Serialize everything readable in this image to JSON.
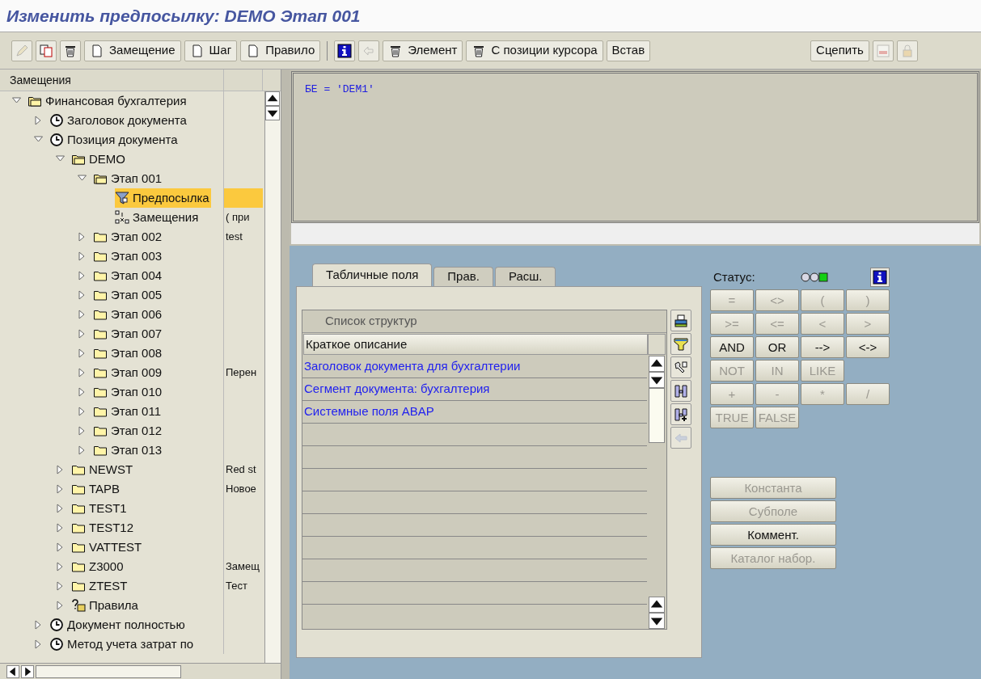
{
  "window": {
    "title": "Изменить предпосылку: DEMO Этап 001"
  },
  "toolbar": [
    {
      "kind": "icon",
      "disabled": true
    },
    {
      "kind": "icon",
      "disabled": false
    },
    {
      "kind": "icon",
      "disabled": false
    },
    {
      "kind": "text",
      "label": "Замещение",
      "disabled": false
    },
    {
      "kind": "text",
      "label": "Шаг",
      "disabled": false
    },
    {
      "kind": "text",
      "label": "Правило",
      "disabled": false
    },
    {
      "kind": "separator"
    },
    {
      "kind": "icon",
      "disabled": false
    },
    {
      "kind": "icon",
      "disabled": true
    },
    {
      "kind": "text",
      "label": "Элемент",
      "disabled": false
    },
    {
      "kind": "text",
      "label": "С позиции курсора",
      "disabled": false
    },
    {
      "kind": "text",
      "label": "Встав",
      "disabled": false
    },
    {
      "kind": "gap"
    },
    {
      "kind": "text",
      "label": "Сцепить",
      "disabled": false
    },
    {
      "kind": "icon",
      "disabled": true
    },
    {
      "kind": "icon",
      "disabled": true
    }
  ],
  "tree": {
    "columns": [
      "Замещения"
    ],
    "items": [
      {
        "label": "Финансовая бухгалтерия",
        "kind": "folder-open",
        "expanded": true,
        "selected": false,
        "children": [
          {
            "label": "Заголовок документа",
            "kind": "clock",
            "expanded": false,
            "selected": false
          },
          {
            "label": "Позиция документа",
            "kind": "clock",
            "expanded": true,
            "selected": false,
            "children": [
              {
                "label": "DEMO",
                "kind": "folder-open",
                "expanded": true,
                "selected": false,
                "children": [
                  {
                    "label": "Этап 001",
                    "kind": "folder-open",
                    "expanded": true,
                    "selected": false,
                    "children": [
                      {
                        "label": "Предпосылка",
                        "kind": "funnel",
                        "selected": true
                      },
                      {
                        "label": "Замещения",
                        "kind": "substitution",
                        "selected": false,
                        "note": "( при"
                      }
                    ]
                  },
                  {
                    "label": "Этап 002",
                    "kind": "folder",
                    "expanded": false,
                    "selected": false,
                    "note": "test"
                  },
                  {
                    "label": "Этап 003",
                    "kind": "folder",
                    "expanded": false,
                    "selected": false
                  },
                  {
                    "label": "Этап 004",
                    "kind": "folder",
                    "expanded": false,
                    "selected": false
                  },
                  {
                    "label": "Этап 005",
                    "kind": "folder",
                    "expanded": false,
                    "selected": false
                  },
                  {
                    "label": "Этап 006",
                    "kind": "folder",
                    "expanded": false,
                    "selected": false
                  },
                  {
                    "label": "Этап 007",
                    "kind": "folder",
                    "expanded": false,
                    "selected": false
                  },
                  {
                    "label": "Этап 008",
                    "kind": "folder",
                    "expanded": false,
                    "selected": false
                  },
                  {
                    "label": "Этап 009",
                    "kind": "folder",
                    "expanded": false,
                    "selected": false,
                    "note": "Перен"
                  },
                  {
                    "label": "Этап 010",
                    "kind": "folder",
                    "expanded": false,
                    "selected": false
                  },
                  {
                    "label": "Этап 011",
                    "kind": "folder",
                    "expanded": false,
                    "selected": false
                  },
                  {
                    "label": "Этап 012",
                    "kind": "folder",
                    "expanded": false,
                    "selected": false
                  },
                  {
                    "label": "Этап 013",
                    "kind": "folder",
                    "expanded": false,
                    "selected": false
                  }
                ]
              },
              {
                "label": "NEWST",
                "kind": "folder",
                "expanded": false,
                "selected": false,
                "note": "Red st"
              },
              {
                "label": "TAPB",
                "kind": "folder",
                "expanded": false,
                "selected": false,
                "note": "Новое"
              },
              {
                "label": "TEST1",
                "kind": "folder",
                "expanded": false,
                "selected": false
              },
              {
                "label": "TEST12",
                "kind": "folder",
                "expanded": false,
                "selected": false
              },
              {
                "label": "VATTEST",
                "kind": "folder",
                "expanded": false,
                "selected": false
              },
              {
                "label": "Z3000",
                "kind": "folder",
                "expanded": false,
                "selected": false,
                "note": "Замещ"
              },
              {
                "label": "ZTEST",
                "kind": "folder",
                "expanded": false,
                "selected": false,
                "note": "Тест"
              },
              {
                "label": "Правила",
                "kind": "rules",
                "expanded": false,
                "selected": false
              }
            ]
          },
          {
            "label": "Документ полностью",
            "kind": "clock",
            "expanded": false,
            "selected": false
          },
          {
            "label": "Метод учета затрат по",
            "kind": "clock",
            "expanded": false,
            "selected": false
          }
        ]
      }
    ]
  },
  "editor": {
    "code": "БЕ = 'DEM1'"
  },
  "tabs": [
    {
      "label": "Табличные поля",
      "selected": true
    },
    {
      "label": "Прав.",
      "selected": false
    },
    {
      "label": "Расш.",
      "selected": false
    }
  ],
  "structure_table": {
    "title": "Список структур",
    "column": "Краткое описание",
    "rows": [
      "Заголовок документа для бухгалтерии",
      "Сегмент документа: бухгалтерия",
      "Системные поля ABAP"
    ]
  },
  "side_tools": [
    {
      "disabled": false
    },
    {
      "disabled": false
    },
    {
      "disabled": false
    },
    {
      "disabled": false
    },
    {
      "disabled": false
    },
    {
      "disabled": true
    }
  ],
  "status": {
    "label": "Статус:"
  },
  "operators": [
    [
      {
        "label": "=",
        "disabled": true
      },
      {
        "label": "<>",
        "disabled": true
      },
      {
        "label": "(",
        "disabled": true
      },
      {
        "label": ")",
        "disabled": true
      }
    ],
    [
      {
        "label": ">=",
        "disabled": true
      },
      {
        "label": "<=",
        "disabled": true
      },
      {
        "label": "<",
        "disabled": true
      },
      {
        "label": ">",
        "disabled": true
      }
    ],
    [
      {
        "label": "AND",
        "disabled": false
      },
      {
        "label": "OR",
        "disabled": false
      },
      {
        "label": "-->",
        "disabled": false
      },
      {
        "label": "<->",
        "disabled": false
      }
    ],
    [
      {
        "label": "NOT",
        "disabled": true
      },
      {
        "label": "IN",
        "disabled": true
      },
      {
        "label": "LIKE",
        "disabled": true
      }
    ],
    [
      {
        "label": "+",
        "disabled": true
      },
      {
        "label": "-",
        "disabled": true
      },
      {
        "label": "*",
        "disabled": true
      },
      {
        "label": "/",
        "disabled": true
      }
    ],
    [
      {
        "label": "TRUE",
        "disabled": true
      },
      {
        "label": "FALSE",
        "disabled": true
      }
    ]
  ],
  "actions": [
    {
      "label": "Константа",
      "disabled": true
    },
    {
      "label": "Субполе",
      "disabled": true
    },
    {
      "label": "Коммент.",
      "disabled": false
    },
    {
      "label": "Каталог набор.",
      "disabled": true
    }
  ]
}
